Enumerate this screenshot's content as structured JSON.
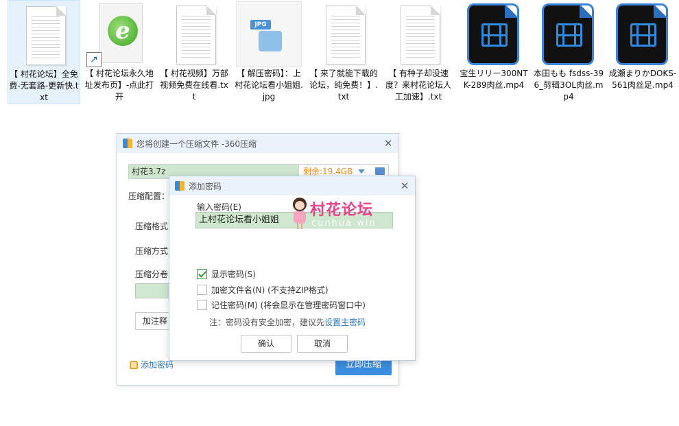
{
  "desktop": {
    "files": [
      {
        "type": "txt",
        "name": "【 村花论坛】全免费-无套路-更新快.txt",
        "selected": true
      },
      {
        "type": "shortcut-e",
        "name": "【 村花论坛永久地址发布页】-点此打开"
      },
      {
        "type": "txt",
        "name": "【 村花视频】万部视频免费在线看.txt"
      },
      {
        "type": "jpg",
        "name": "【 解压密码】：上村花论坛看小姐姐.jpg",
        "badge": "JPG"
      },
      {
        "type": "txt",
        "name": "【 来了就能下载的论坛，纯免费！】.txt"
      },
      {
        "type": "txt",
        "name": "【 有种子却没速度？来村花论坛人工加速】.txt"
      },
      {
        "type": "mp4",
        "name": "宝生リリー300NTK-289肉丝.mp4"
      },
      {
        "type": "mp4",
        "name": "本田もも fsdss-396_剪辑3OL肉丝.mp4"
      },
      {
        "type": "mp4",
        "name": "成瀬まりかDOKS-561肉丝足.mp4"
      }
    ]
  },
  "zip_dialog": {
    "title": "您将创建一个压缩文件 -360压缩",
    "filename": "村花3.7z",
    "free_space": "剩余:19.4GB",
    "config_label": "压缩配置：",
    "format_label": "压缩格式",
    "method_label": "压缩方式",
    "split_label": "压缩分卷",
    "add_note_label": "加注释",
    "add_password_link": "添加密码",
    "compress_button": "立即压缩"
  },
  "password_dialog": {
    "title": "添加密码",
    "input_label": "输入密码(E)",
    "password_value": "上村花论坛看小姐姐",
    "show_password": {
      "label": "显示密码(S)",
      "checked": true
    },
    "encrypt_filenames": {
      "label": "加密文件名(N) (不支持ZIP格式)",
      "checked": false
    },
    "remember_password": {
      "label": "记住密码(M) (将会显示在管理密码窗口中)",
      "checked": false
    },
    "note_prefix": "注：密码没有安全加密，建议先",
    "note_link": "设置主密码",
    "ok_button": "确认",
    "cancel_button": "取消"
  },
  "watermark": {
    "title": "村花论坛",
    "subtitle": "cunhua win"
  },
  "colors": {
    "accent": "#3b8de0",
    "field_green": "#cfe7cf",
    "free_space": "#f08c1f",
    "link": "#2a7ac5",
    "watermark": "#e9438c"
  }
}
